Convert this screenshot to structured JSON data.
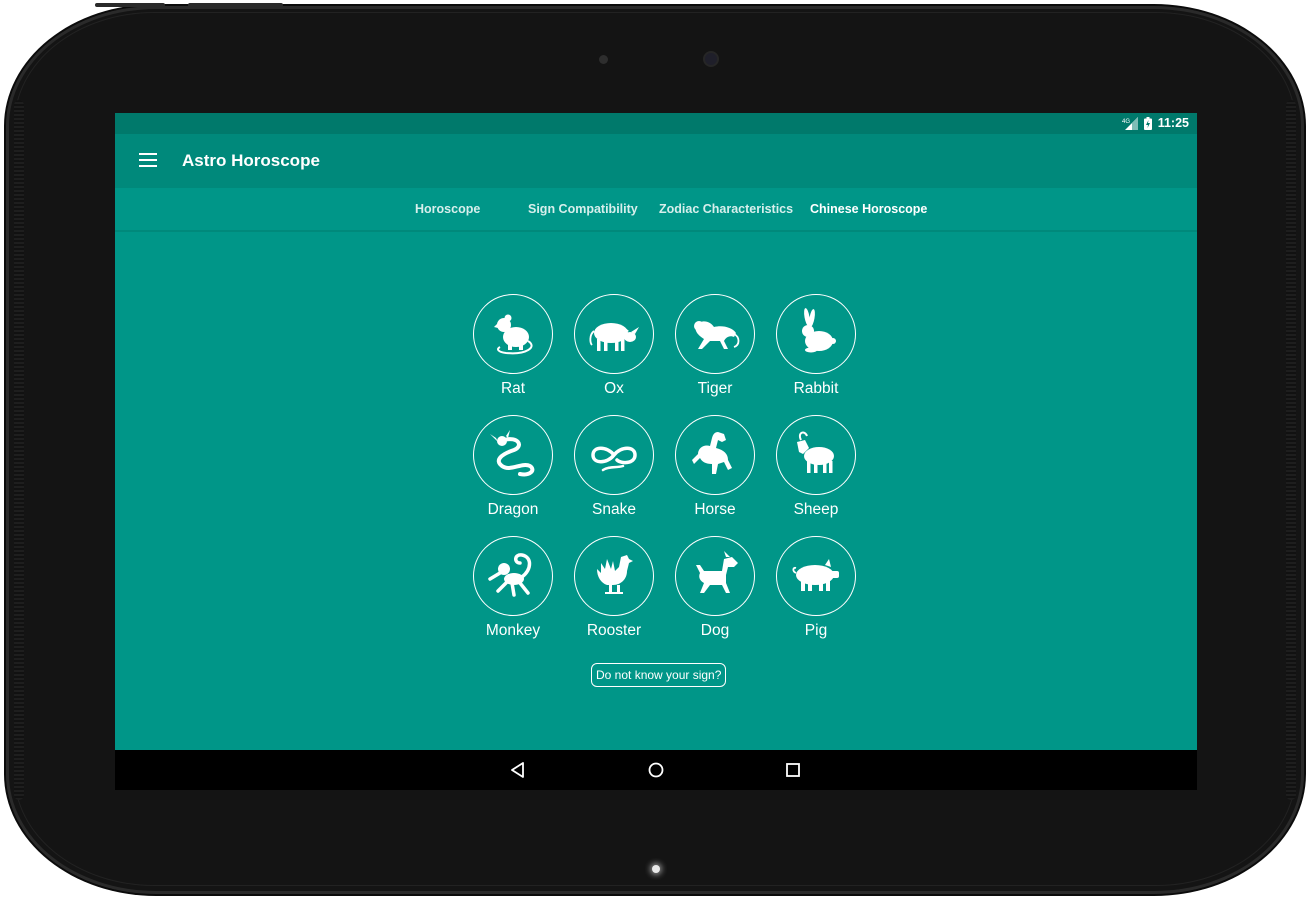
{
  "status_bar": {
    "network": "4G",
    "time": "11:25"
  },
  "app_bar": {
    "title": "Astro Horoscope",
    "menu_icon": "hamburger-menu-icon"
  },
  "tabs": [
    {
      "label": "Horoscope",
      "active": false
    },
    {
      "label": "Sign Compatibility",
      "active": false
    },
    {
      "label": "Zodiac Characteristics",
      "active": false
    },
    {
      "label": "Chinese Horoscope",
      "active": true
    }
  ],
  "signs": [
    {
      "label": "Rat",
      "icon": "rat-icon"
    },
    {
      "label": "Ox",
      "icon": "ox-icon"
    },
    {
      "label": "Tiger",
      "icon": "tiger-icon"
    },
    {
      "label": "Rabbit",
      "icon": "rabbit-icon"
    },
    {
      "label": "Dragon",
      "icon": "dragon-icon"
    },
    {
      "label": "Snake",
      "icon": "snake-icon"
    },
    {
      "label": "Horse",
      "icon": "horse-icon"
    },
    {
      "label": "Sheep",
      "icon": "sheep-icon"
    },
    {
      "label": "Monkey",
      "icon": "monkey-icon"
    },
    {
      "label": "Rooster",
      "icon": "rooster-icon"
    },
    {
      "label": "Dog",
      "icon": "dog-icon"
    },
    {
      "label": "Pig",
      "icon": "pig-icon"
    }
  ],
  "help_button": {
    "label": "Do not know your sign?"
  },
  "nav_bar": {
    "back": "back-triangle-icon",
    "home": "home-circle-icon",
    "recents": "recents-square-icon"
  },
  "colors": {
    "status_bar": "#00796b",
    "app_bar": "#00897b",
    "background": "#009688",
    "text": "#ffffff"
  }
}
